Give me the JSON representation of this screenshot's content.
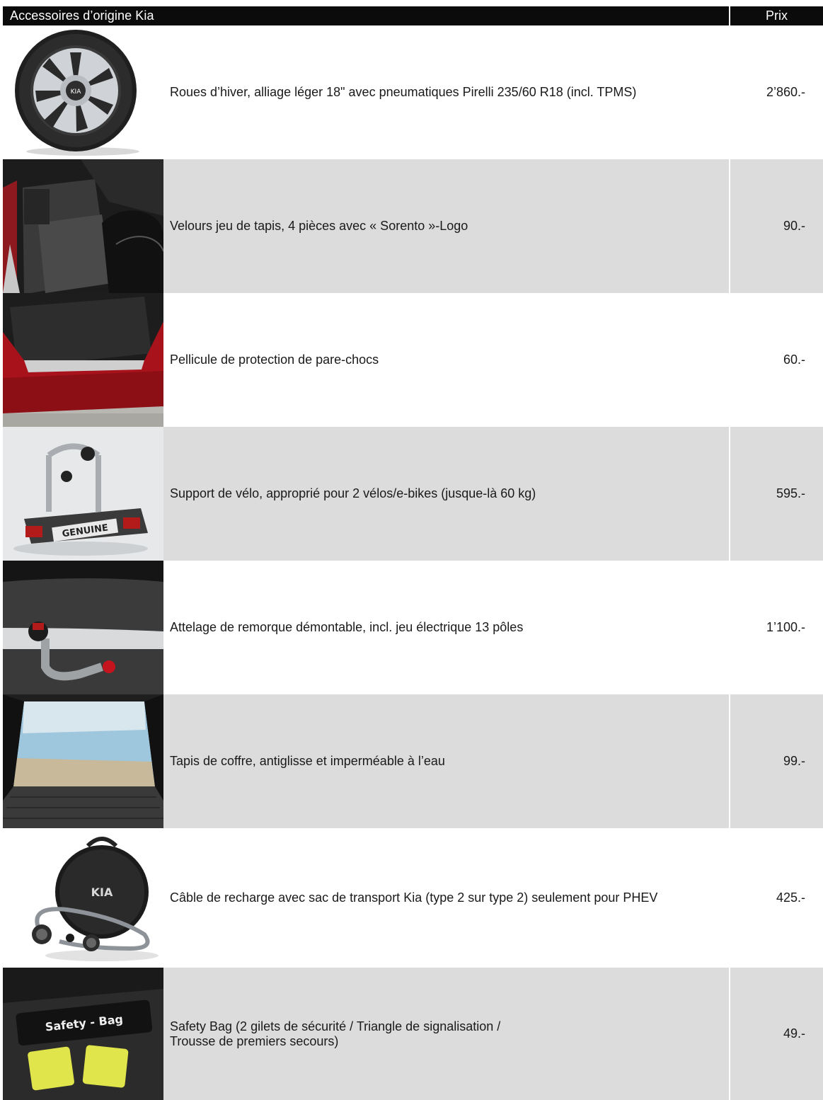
{
  "header": {
    "title": "Accessoires d’origine Kia",
    "price_label": "Prix"
  },
  "items": [
    {
      "description": "Roues d’hiver, alliage léger 18\" avec pneumatiques Pirelli 235/60 R18 (incl. TPMS)",
      "price": "2’860.-",
      "icon": "wheel-image"
    },
    {
      "description": "Velours jeu de tapis, 4 pièces avec « Sorento »-Logo",
      "price": "90.-",
      "icon": "floor-mat-image"
    },
    {
      "description": "Pellicule de protection de pare-chocs",
      "price": "60.-",
      "icon": "bumper-film-image"
    },
    {
      "description": "Support de vélo, approprié pour 2 vélos/e-bikes (jusque-là 60 kg)",
      "price": "595.-",
      "icon": "bike-carrier-image",
      "image_text": "GENUINE"
    },
    {
      "description": "Attelage de remorque démontable, incl. jeu électrique 13 pôles",
      "price": "1’100.-",
      "icon": "tow-hitch-image"
    },
    {
      "description": "Tapis de coffre, antiglisse et imperméable à l’eau",
      "price": "99.-",
      "icon": "trunk-mat-image"
    },
    {
      "description": "Câble de recharge avec sac de transport Kia (type 2 sur type 2) seulement pour PHEV",
      "price": "425.-",
      "icon": "charging-cable-image",
      "image_text": "KIA"
    },
    {
      "description": "Safety Bag (2 gilets de sécurité / Triangle de signalisation /\nTrousse de premiers secours)",
      "price": "49.-",
      "icon": "safety-bag-image",
      "image_text": "Safety - Bag"
    }
  ],
  "colors": {
    "header_bg": "#0b0b0b",
    "row_alt_bg": "#dcdcdd",
    "kia_red": "#b5121b"
  }
}
